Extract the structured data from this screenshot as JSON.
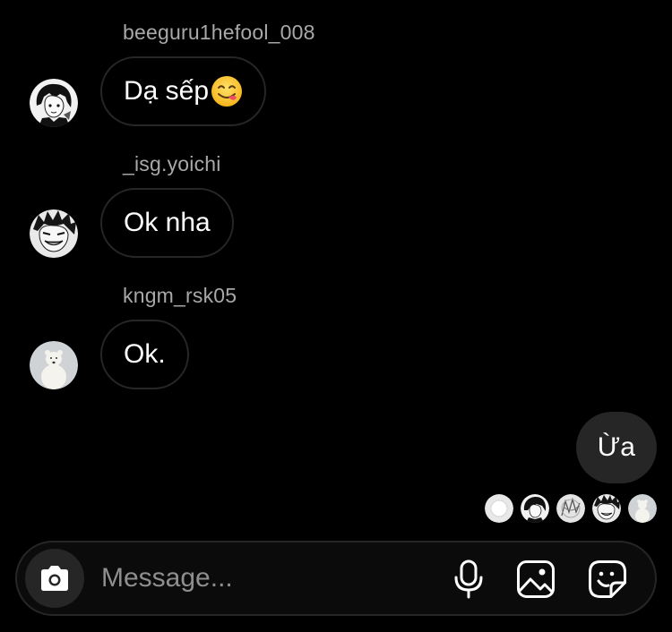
{
  "messages": [
    {
      "sender": "beeguru1hefool_008",
      "text": "Dạ sếp",
      "emoji": "yum-face-emoji",
      "avatar": "anime-boy-avatar"
    },
    {
      "sender": "_isg.yoichi",
      "text": "Ok nha",
      "avatar": "anime-grin-avatar"
    },
    {
      "sender": "kngm_rsk05",
      "text": "Ok.",
      "avatar": "polar-bear-avatar"
    }
  ],
  "outgoing": {
    "text": "Ừa"
  },
  "seen_by": [
    "default-avatar",
    "anime-boy-avatar",
    "sketch-avatar",
    "anime-grin-avatar",
    "polar-bear-avatar"
  ],
  "composer": {
    "placeholder": "Message...",
    "value": "",
    "icons": [
      "camera-icon",
      "microphone-icon",
      "gallery-icon",
      "sticker-icon"
    ]
  },
  "colors": {
    "background": "#000000",
    "bubble_border": "#262626",
    "outgoing_bubble": "#262626",
    "username": "#a8a8a8",
    "placeholder": "#8e8e8e"
  }
}
